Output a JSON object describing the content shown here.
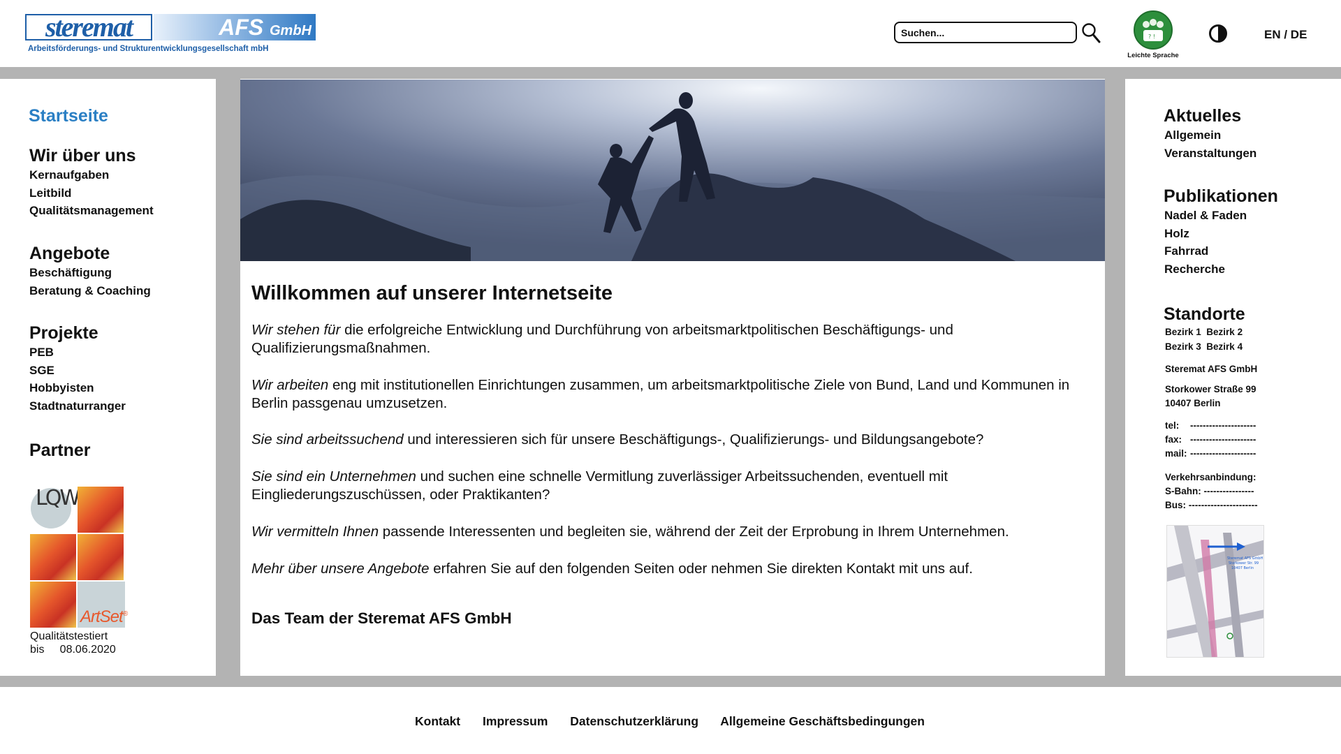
{
  "header": {
    "logo_brand": "steremat",
    "logo_afs": "AFS",
    "logo_gmbh": "GmbH",
    "logo_tagline": "Arbeitsförderungs-  und  Strukturentwicklungsgesellschaft  mbH",
    "search_placeholder": "Suchen...",
    "easy_language_label": "Leichte Sprache",
    "lang_en": "EN",
    "lang_sep": " / ",
    "lang_de": "DE"
  },
  "left_nav": {
    "home": "Startseite",
    "sections": [
      {
        "title": "Wir über uns",
        "items": [
          "Kernaufgaben",
          "Leitbild",
          "Qualitätsmanagement"
        ]
      },
      {
        "title": "Angebote",
        "items": [
          "Beschäftigung",
          "Beratung & Coaching"
        ]
      },
      {
        "title": "Projekte",
        "items": [
          "PEB",
          "SGE",
          "Hobbyisten",
          "Stadtnaturranger"
        ]
      },
      {
        "title": "Partner",
        "items": []
      }
    ],
    "certificate": {
      "lqw": "LQW",
      "artset": "ArtSet",
      "artset_mark": "®",
      "line1": "Qualitätstestiert",
      "line2": "bis     08.06.2020"
    }
  },
  "main": {
    "title": "Willkommen auf unserer Internetseite",
    "paragraphs": [
      {
        "em": "Wir stehen für",
        "text": " die erfolgreiche Entwicklung und Durchführung von arbeitsmarktpolitischen Beschäftigungs- und Qualifizierungsmaßnahmen."
      },
      {
        "em": "Wir arbeiten",
        "text": " eng mit institutionellen Einrichtungen zusammen, um arbeitsmarktpolitische Ziele von Bund, Land und Kommunen in Berlin passgenau umzusetzen."
      },
      {
        "em": "Sie sind arbeitssuchend",
        "text": " und interessieren sich für unsere Beschäftigungs-, Qualifizierungs- und Bildungsangebote?"
      },
      {
        "em": "Sie sind ein Unternehmen",
        "text": " und suchen eine schnelle Vermitlung zuverlässiger Arbeitssuchenden, eventuell mit Eingliederungszuschüssen, oder Praktikanten?"
      },
      {
        "em": "Wir vermitteln Ihnen",
        "text": " passende Interessenten und begleiten sie, während der Zeit der Erprobung in Ihrem Unternehmen."
      },
      {
        "em": "Mehr über unsere Angebote",
        "text": " erfahren Sie auf den folgenden Seiten oder nehmen Sie direkten Kontakt mit uns auf."
      }
    ],
    "signature": "Das Team der Steremat AFS GmbH"
  },
  "right_col": {
    "news_title": "Aktuelles",
    "news_items": [
      "Allgemein",
      "Veranstaltungen"
    ],
    "pub_title": "Publikationen",
    "pub_items": [
      "Nadel & Faden",
      "Holz",
      "Fahrrad",
      "Recherche"
    ],
    "loc_title": "Standorte",
    "districts_row1": [
      "Bezirk 1",
      "Bezirk 2"
    ],
    "districts_row2": [
      "Bezirk 3",
      "Bezirk 4"
    ],
    "company": "Steremat AFS GmbH",
    "street": "Storkower Straße 99",
    "city": "10407 Berlin",
    "tel_label": "tel:",
    "tel_value": "---------------------",
    "fax_label": "fax:",
    "fax_value": "---------------------",
    "mail_label": "mail:",
    "mail_value": "---------------------",
    "transport_label": "Verkehrsanbindung:",
    "sbahn_label": "S-Bahn:",
    "sbahn_value": "----------------",
    "bus_label": "Bus:",
    "bus_value": "----------------------",
    "map_label_1": "Steremat AFS GmbH",
    "map_label_2": "Storkower Str. 99",
    "map_label_3": "10407 Berlin"
  },
  "footer": {
    "links": [
      "Kontakt",
      "Impressum",
      "Datenschutzerklärung",
      "Allgemeine Geschäftsbedingungen"
    ]
  },
  "colors": {
    "brand_blue": "#1e5fa8",
    "active_link": "#2a7fc4",
    "frame_gray": "#b3b3b3",
    "easy_language_green": "#2d8f3c"
  }
}
